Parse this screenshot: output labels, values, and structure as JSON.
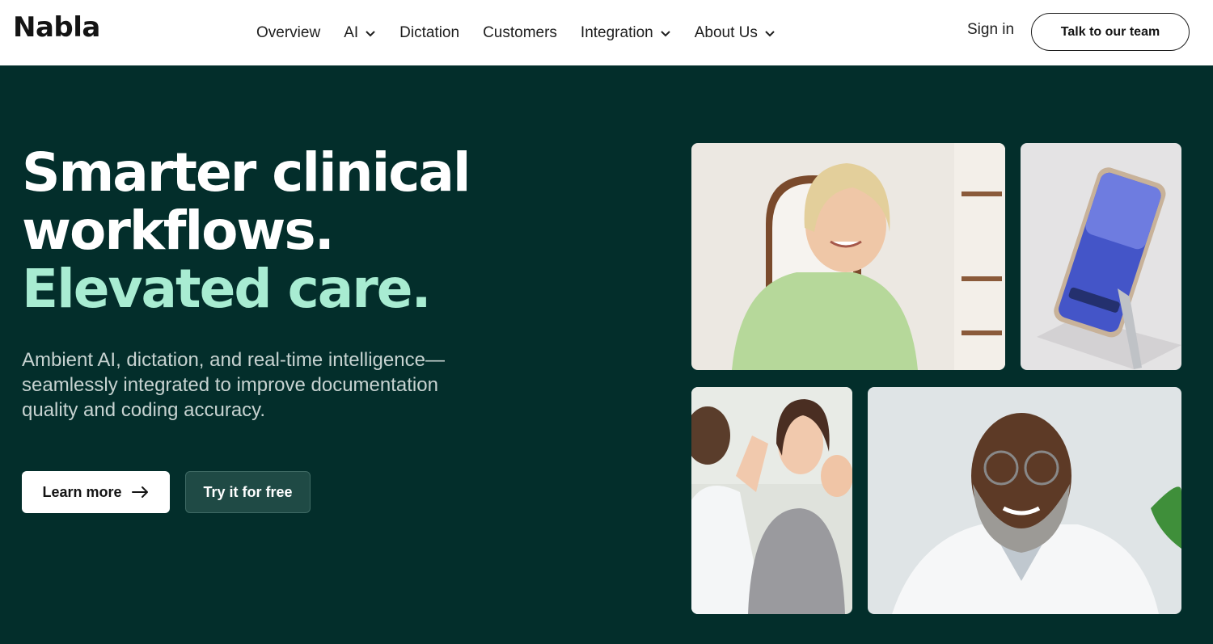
{
  "brand": {
    "name": "Nabla"
  },
  "nav": {
    "items": [
      {
        "label": "Overview",
        "has_dropdown": false
      },
      {
        "label": "AI",
        "has_dropdown": true
      },
      {
        "label": "Dictation",
        "has_dropdown": false
      },
      {
        "label": "Customers",
        "has_dropdown": false
      },
      {
        "label": "Integration",
        "has_dropdown": true
      },
      {
        "label": "About Us",
        "has_dropdown": true
      }
    ],
    "sign_in": "Sign in",
    "cta": "Talk to our team"
  },
  "hero": {
    "headline_line1": "Smarter clinical",
    "headline_line2": "workflows.",
    "headline_accent": "Elevated care.",
    "subtitle": "Ambient AI, dictation, and real-time intelligence—seamlessly integrated to improve documentation quality and coding accuracy.",
    "primary_button": "Learn more",
    "secondary_button": "Try it for free"
  },
  "images": [
    {
      "name": "smiling-woman-green-sweater-photo"
    },
    {
      "name": "phone-on-stand-photo"
    },
    {
      "name": "doctor-high-five-family-photo"
    },
    {
      "name": "smiling-doctor-glasses-photo"
    }
  ],
  "colors": {
    "hero_bg": "#032e2b",
    "accent": "#a8ecd2",
    "secondary_button_bg": "#1f4a45",
    "nav_bg": "#ffffff"
  }
}
